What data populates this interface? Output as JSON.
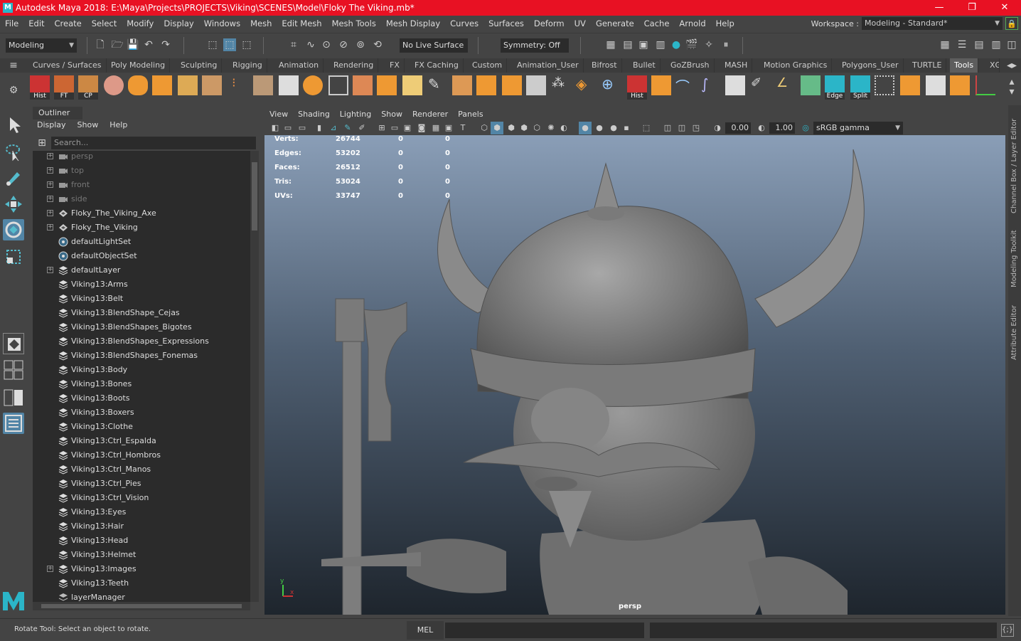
{
  "window": {
    "title": "Autodesk Maya 2018: E:\\Maya\\Projects\\PROJECTS\\Viking\\SCENES\\Model\\Floky The Viking.mb*",
    "logo_letter": "M"
  },
  "menubar": {
    "items": [
      "File",
      "Edit",
      "Create",
      "Select",
      "Modify",
      "Display",
      "Windows",
      "Mesh",
      "Edit Mesh",
      "Mesh Tools",
      "Mesh Display",
      "Curves",
      "Surfaces",
      "Deform",
      "UV",
      "Generate",
      "Cache",
      "Arnold",
      "Help"
    ],
    "workspace_label": "Workspace :",
    "workspace_value": "Modeling - Standard*"
  },
  "statusline": {
    "menuset": "Modeling",
    "live_surface": "No Live Surface",
    "symmetry": "Symmetry: Off"
  },
  "shelf": {
    "tabs": [
      "Curves / Surfaces",
      "Poly Modeling",
      "Sculpting",
      "Rigging",
      "Animation",
      "Rendering",
      "FX",
      "FX Caching",
      "Custom",
      "Animation_User",
      "Bifrost",
      "Bullet",
      "GoZBrush",
      "MASH",
      "Motion Graphics",
      "Polygons_User",
      "TURTLE",
      "Tools",
      "XG"
    ],
    "active_tab": "Tools",
    "icon_labels": {
      "hist": "Hist",
      "ft": "FT",
      "cp": "CP",
      "hist2": "Hist",
      "edge": "Edge",
      "split": "Split"
    }
  },
  "outliner": {
    "title": "Outliner",
    "menu": [
      "Display",
      "Show",
      "Help"
    ],
    "search_placeholder": "Search...",
    "items": [
      {
        "label": "persp",
        "icon": "camera-icon",
        "expand": true,
        "dim": true
      },
      {
        "label": "top",
        "icon": "camera-icon",
        "expand": true,
        "dim": true
      },
      {
        "label": "front",
        "icon": "camera-icon",
        "expand": true,
        "dim": true
      },
      {
        "label": "side",
        "icon": "camera-icon",
        "expand": true,
        "dim": true
      },
      {
        "label": "Floky_The_Viking_Axe",
        "icon": "group-icon",
        "expand": true,
        "dim": false
      },
      {
        "label": "Floky_The_Viking",
        "icon": "group-icon",
        "expand": true,
        "dim": false
      },
      {
        "label": "defaultLightSet",
        "icon": "set-icon",
        "expand": false,
        "dim": false
      },
      {
        "label": "defaultObjectSet",
        "icon": "set-icon",
        "expand": false,
        "dim": false
      },
      {
        "label": "defaultLayer",
        "icon": "layer-icon",
        "expand": true,
        "dim": false
      },
      {
        "label": "Viking13:Arms",
        "icon": "layer-icon",
        "expand": false,
        "dim": false
      },
      {
        "label": "Viking13:Belt",
        "icon": "layer-icon",
        "expand": false,
        "dim": false
      },
      {
        "label": "Viking13:BlendShape_Cejas",
        "icon": "layer-icon",
        "expand": false,
        "dim": false
      },
      {
        "label": "Viking13:BlendShapes_Bigotes",
        "icon": "layer-icon",
        "expand": false,
        "dim": false
      },
      {
        "label": "Viking13:BlendShapes_Expressions",
        "icon": "layer-icon",
        "expand": false,
        "dim": false
      },
      {
        "label": "Viking13:BlendShapes_Fonemas",
        "icon": "layer-icon",
        "expand": false,
        "dim": false
      },
      {
        "label": "Viking13:Body",
        "icon": "layer-icon",
        "expand": false,
        "dim": false
      },
      {
        "label": "Viking13:Bones",
        "icon": "layer-icon",
        "expand": false,
        "dim": false
      },
      {
        "label": "Viking13:Boots",
        "icon": "layer-icon",
        "expand": false,
        "dim": false
      },
      {
        "label": "Viking13:Boxers",
        "icon": "layer-icon",
        "expand": false,
        "dim": false
      },
      {
        "label": "Viking13:Clothe",
        "icon": "layer-icon",
        "expand": false,
        "dim": false
      },
      {
        "label": "Viking13:Ctrl_Espalda",
        "icon": "layer-icon",
        "expand": false,
        "dim": false
      },
      {
        "label": "Viking13:Ctrl_Hombros",
        "icon": "layer-icon",
        "expand": false,
        "dim": false
      },
      {
        "label": "Viking13:Ctrl_Manos",
        "icon": "layer-icon",
        "expand": false,
        "dim": false
      },
      {
        "label": "Viking13:Ctrl_Pies",
        "icon": "layer-icon",
        "expand": false,
        "dim": false
      },
      {
        "label": "Viking13:Ctrl_Vision",
        "icon": "layer-icon",
        "expand": false,
        "dim": false
      },
      {
        "label": "Viking13:Eyes",
        "icon": "layer-icon",
        "expand": false,
        "dim": false
      },
      {
        "label": "Viking13:Hair",
        "icon": "layer-icon",
        "expand": false,
        "dim": false
      },
      {
        "label": "Viking13:Head",
        "icon": "layer-icon",
        "expand": false,
        "dim": false
      },
      {
        "label": "Viking13:Helmet",
        "icon": "layer-icon",
        "expand": false,
        "dim": false
      },
      {
        "label": "Viking13:Images",
        "icon": "layer-icon",
        "expand": true,
        "dim": false
      },
      {
        "label": "Viking13:Teeth",
        "icon": "layer-icon",
        "expand": false,
        "dim": false
      },
      {
        "label": "layerManager",
        "icon": "layer-manager-icon",
        "expand": false,
        "dim": false
      }
    ]
  },
  "viewport": {
    "menu": [
      "View",
      "Shading",
      "Lighting",
      "Show",
      "Renderer",
      "Panels"
    ],
    "near_value": "0.00",
    "far_value": "1.00",
    "color_space": "sRGB gamma",
    "camera_label": "persp",
    "hud": [
      {
        "label": "Verts:",
        "total": "26744",
        "sel": "0",
        "comp": "0"
      },
      {
        "label": "Edges:",
        "total": "53202",
        "sel": "0",
        "comp": "0"
      },
      {
        "label": "Faces:",
        "total": "26512",
        "sel": "0",
        "comp": "0"
      },
      {
        "label": "Tris:",
        "total": "53024",
        "sel": "0",
        "comp": "0"
      },
      {
        "label": "UVs:",
        "total": "33747",
        "sel": "0",
        "comp": "0"
      }
    ],
    "axis_y": "y",
    "axis_x": "x"
  },
  "sidetabs": [
    "Channel Box / Layer Editor",
    "Modeling Toolkit",
    "Attribute Editor"
  ],
  "helpline": {
    "message": "Rotate Tool: Select an object to rotate.",
    "mel_label": "MEL"
  },
  "colors": {
    "accent": "#5285a6",
    "titlebar": "#e81123",
    "maya_logo": "#2bb5c8"
  }
}
